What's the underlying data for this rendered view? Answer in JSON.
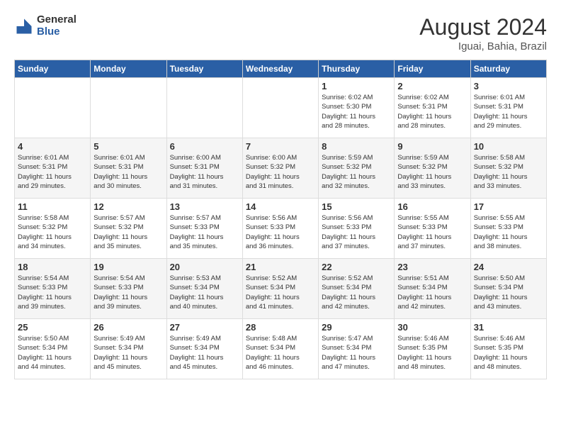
{
  "header": {
    "logo_general": "General",
    "logo_blue": "Blue",
    "month_year": "August 2024",
    "location": "Iguai, Bahia, Brazil"
  },
  "days_of_week": [
    "Sunday",
    "Monday",
    "Tuesday",
    "Wednesday",
    "Thursday",
    "Friday",
    "Saturday"
  ],
  "weeks": [
    [
      {
        "day": "",
        "info": ""
      },
      {
        "day": "",
        "info": ""
      },
      {
        "day": "",
        "info": ""
      },
      {
        "day": "",
        "info": ""
      },
      {
        "day": "1",
        "info": "Sunrise: 6:02 AM\nSunset: 5:30 PM\nDaylight: 11 hours\nand 28 minutes."
      },
      {
        "day": "2",
        "info": "Sunrise: 6:02 AM\nSunset: 5:31 PM\nDaylight: 11 hours\nand 28 minutes."
      },
      {
        "day": "3",
        "info": "Sunrise: 6:01 AM\nSunset: 5:31 PM\nDaylight: 11 hours\nand 29 minutes."
      }
    ],
    [
      {
        "day": "4",
        "info": "Sunrise: 6:01 AM\nSunset: 5:31 PM\nDaylight: 11 hours\nand 29 minutes."
      },
      {
        "day": "5",
        "info": "Sunrise: 6:01 AM\nSunset: 5:31 PM\nDaylight: 11 hours\nand 30 minutes."
      },
      {
        "day": "6",
        "info": "Sunrise: 6:00 AM\nSunset: 5:31 PM\nDaylight: 11 hours\nand 31 minutes."
      },
      {
        "day": "7",
        "info": "Sunrise: 6:00 AM\nSunset: 5:32 PM\nDaylight: 11 hours\nand 31 minutes."
      },
      {
        "day": "8",
        "info": "Sunrise: 5:59 AM\nSunset: 5:32 PM\nDaylight: 11 hours\nand 32 minutes."
      },
      {
        "day": "9",
        "info": "Sunrise: 5:59 AM\nSunset: 5:32 PM\nDaylight: 11 hours\nand 33 minutes."
      },
      {
        "day": "10",
        "info": "Sunrise: 5:58 AM\nSunset: 5:32 PM\nDaylight: 11 hours\nand 33 minutes."
      }
    ],
    [
      {
        "day": "11",
        "info": "Sunrise: 5:58 AM\nSunset: 5:32 PM\nDaylight: 11 hours\nand 34 minutes."
      },
      {
        "day": "12",
        "info": "Sunrise: 5:57 AM\nSunset: 5:32 PM\nDaylight: 11 hours\nand 35 minutes."
      },
      {
        "day": "13",
        "info": "Sunrise: 5:57 AM\nSunset: 5:33 PM\nDaylight: 11 hours\nand 35 minutes."
      },
      {
        "day": "14",
        "info": "Sunrise: 5:56 AM\nSunset: 5:33 PM\nDaylight: 11 hours\nand 36 minutes."
      },
      {
        "day": "15",
        "info": "Sunrise: 5:56 AM\nSunset: 5:33 PM\nDaylight: 11 hours\nand 37 minutes."
      },
      {
        "day": "16",
        "info": "Sunrise: 5:55 AM\nSunset: 5:33 PM\nDaylight: 11 hours\nand 37 minutes."
      },
      {
        "day": "17",
        "info": "Sunrise: 5:55 AM\nSunset: 5:33 PM\nDaylight: 11 hours\nand 38 minutes."
      }
    ],
    [
      {
        "day": "18",
        "info": "Sunrise: 5:54 AM\nSunset: 5:33 PM\nDaylight: 11 hours\nand 39 minutes."
      },
      {
        "day": "19",
        "info": "Sunrise: 5:54 AM\nSunset: 5:33 PM\nDaylight: 11 hours\nand 39 minutes."
      },
      {
        "day": "20",
        "info": "Sunrise: 5:53 AM\nSunset: 5:34 PM\nDaylight: 11 hours\nand 40 minutes."
      },
      {
        "day": "21",
        "info": "Sunrise: 5:52 AM\nSunset: 5:34 PM\nDaylight: 11 hours\nand 41 minutes."
      },
      {
        "day": "22",
        "info": "Sunrise: 5:52 AM\nSunset: 5:34 PM\nDaylight: 11 hours\nand 42 minutes."
      },
      {
        "day": "23",
        "info": "Sunrise: 5:51 AM\nSunset: 5:34 PM\nDaylight: 11 hours\nand 42 minutes."
      },
      {
        "day": "24",
        "info": "Sunrise: 5:50 AM\nSunset: 5:34 PM\nDaylight: 11 hours\nand 43 minutes."
      }
    ],
    [
      {
        "day": "25",
        "info": "Sunrise: 5:50 AM\nSunset: 5:34 PM\nDaylight: 11 hours\nand 44 minutes."
      },
      {
        "day": "26",
        "info": "Sunrise: 5:49 AM\nSunset: 5:34 PM\nDaylight: 11 hours\nand 45 minutes."
      },
      {
        "day": "27",
        "info": "Sunrise: 5:49 AM\nSunset: 5:34 PM\nDaylight: 11 hours\nand 45 minutes."
      },
      {
        "day": "28",
        "info": "Sunrise: 5:48 AM\nSunset: 5:34 PM\nDaylight: 11 hours\nand 46 minutes."
      },
      {
        "day": "29",
        "info": "Sunrise: 5:47 AM\nSunset: 5:34 PM\nDaylight: 11 hours\nand 47 minutes."
      },
      {
        "day": "30",
        "info": "Sunrise: 5:46 AM\nSunset: 5:35 PM\nDaylight: 11 hours\nand 48 minutes."
      },
      {
        "day": "31",
        "info": "Sunrise: 5:46 AM\nSunset: 5:35 PM\nDaylight: 11 hours\nand 48 minutes."
      }
    ]
  ]
}
